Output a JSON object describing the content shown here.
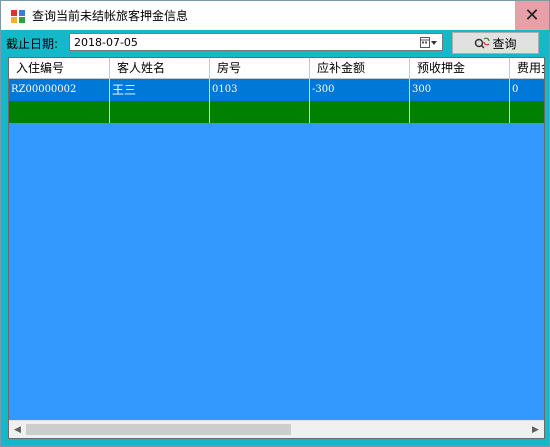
{
  "window": {
    "title": "查询当前未结帐旅客押金信息"
  },
  "toolbar": {
    "date_label": "截止日期:",
    "date_value": "2018-07-05",
    "query_label": "查询"
  },
  "grid": {
    "columns": [
      "入住编号",
      "客人姓名",
      "房号",
      "应补金额",
      "预收押金",
      "费用金"
    ],
    "rows": [
      [
        "RZ00000002",
        "王三",
        "0103",
        "-300",
        "300",
        "0"
      ]
    ]
  },
  "colors": {
    "background": "#15b8c8",
    "grid_bg": "#3399ff",
    "selected_row": "#0078d7",
    "new_row": "#008000"
  },
  "icons": [
    "app-icon",
    "close-icon",
    "calendar-icon",
    "search-refresh-icon",
    "chevron-left-icon",
    "chevron-right-icon"
  ]
}
